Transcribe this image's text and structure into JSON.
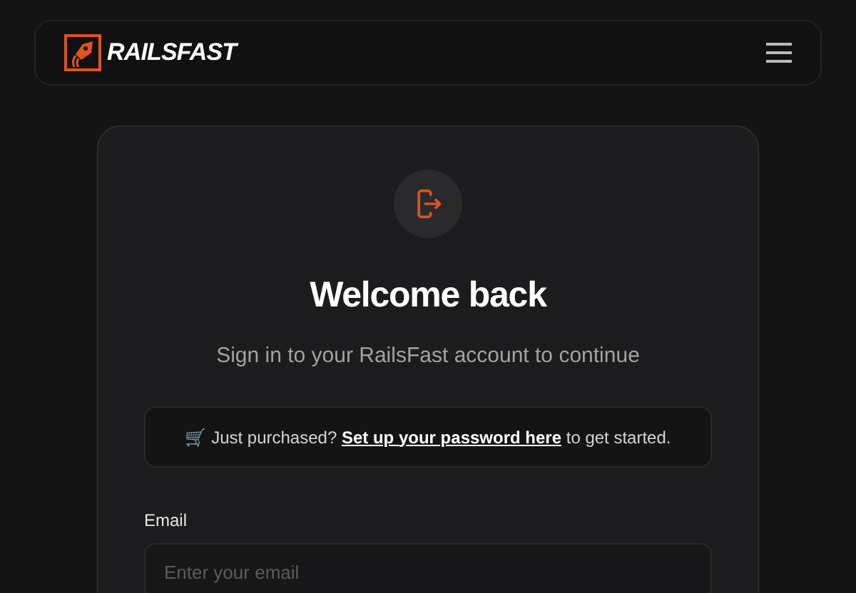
{
  "header": {
    "brand": "RAILSFAST"
  },
  "card": {
    "title": "Welcome back",
    "subtitle": "Sign in to your RailsFast account to continue",
    "notice": {
      "prefix": "🛒 Just purchased?",
      "link": "Set up your password here",
      "suffix": "to get started."
    },
    "fields": [
      {
        "label": "Email",
        "placeholder": "Enter your email"
      }
    ]
  }
}
